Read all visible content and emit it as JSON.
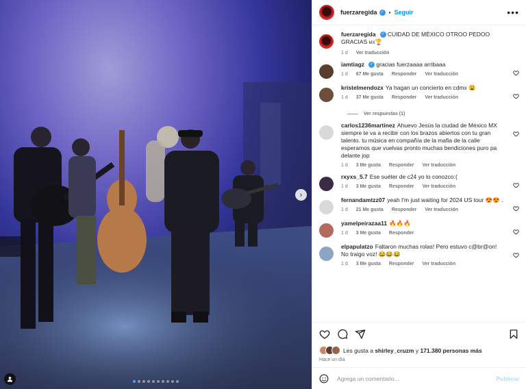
{
  "post": {
    "username": "fuerzaregida",
    "follow_label": "Seguir",
    "more_label": "•••",
    "caption_text": "CUIDAD DE MÉXICO OTROO PEDOO GRACIAS ",
    "caption_flag": "MX",
    "caption_time": "1 d",
    "caption_translate": "Ver traducción"
  },
  "photo": {
    "next_glyph": "›",
    "slide_count": 10,
    "active_slide": 0
  },
  "comments": [
    {
      "user": "iamtiagz",
      "verified": true,
      "text": "gracias fuerzaaaa arribaaa",
      "time": "1 d",
      "likes": "67 Me gusta",
      "reply": "Responder",
      "translate": "Ver traducción",
      "avatar": "#5a3d2b"
    },
    {
      "user": "kristelmendozx",
      "verified": false,
      "text": "Ya hagan un concierto en cdmx 😩",
      "time": "1 d",
      "likes": "37 Me gusta",
      "reply": "Responder",
      "translate": "Ver traducción",
      "avatar": "#6b4f3a",
      "replies": "Ver respuestas (1)"
    },
    {
      "user": "carlos1236martinez",
      "verified": false,
      "text": "Ahuevo Jesús la ciudad de México MX siempre te va a recibir con los brazos abiertos con tu gran talento. tu música en compañía de la mafia de la calle esperamos que vuelvas pronto muchas bendiciones puro pa delante jop",
      "time": "1 d",
      "likes": "3 Me gusta",
      "reply": "Responder",
      "translate": "Ver traducción",
      "avatar": "#d9d9d9"
    },
    {
      "user": "rxyxs_5.7",
      "verified": false,
      "text": "Ese suéter de c24 yo lo conozco:(",
      "time": "1 d",
      "likes": "3 Me gusta",
      "reply": "Responder",
      "translate": "Ver traducción",
      "avatar": "#3b2b45"
    },
    {
      "user": "fernandamtzz07",
      "verified": false,
      "text": "yeah I'm just waiting for 2024 US tour 😍😍 .",
      "time": "1 d",
      "likes": "21 Me gusta",
      "reply": "Responder",
      "translate": "Ver traducción",
      "avatar": "#d9d9d9"
    },
    {
      "user": "yamelpeirazaa11",
      "verified": false,
      "text": "🔥🔥🔥",
      "time": "1 d",
      "likes": "3 Me gusta",
      "reply": "Responder",
      "translate": "",
      "avatar": "#b36a5e"
    },
    {
      "user": "elpapulatzo",
      "verified": false,
      "text": "Faltaron muchas rolas! Pero estuvo c@br@on! No traigo voz! 😂😂😂",
      "time": "1 d",
      "likes": "3 Me gusta",
      "reply": "Responder",
      "translate": "Ver traducción",
      "avatar": "#8aa6c1"
    }
  ],
  "actions": {
    "likes_prefix": "Les gusta a ",
    "likes_user": "shirley_cruzm",
    "likes_mid": " y ",
    "likes_count": "171.380 personas más",
    "posted_ago": "Hace un día"
  },
  "compose": {
    "placeholder": "Agrega un comentario...",
    "post_label": "Publicar"
  },
  "icons": [
    "heart-icon",
    "comment-icon",
    "share-icon",
    "bookmark-icon",
    "emoji-icon",
    "more-icon",
    "chevron-right-icon",
    "user-tag-icon"
  ]
}
